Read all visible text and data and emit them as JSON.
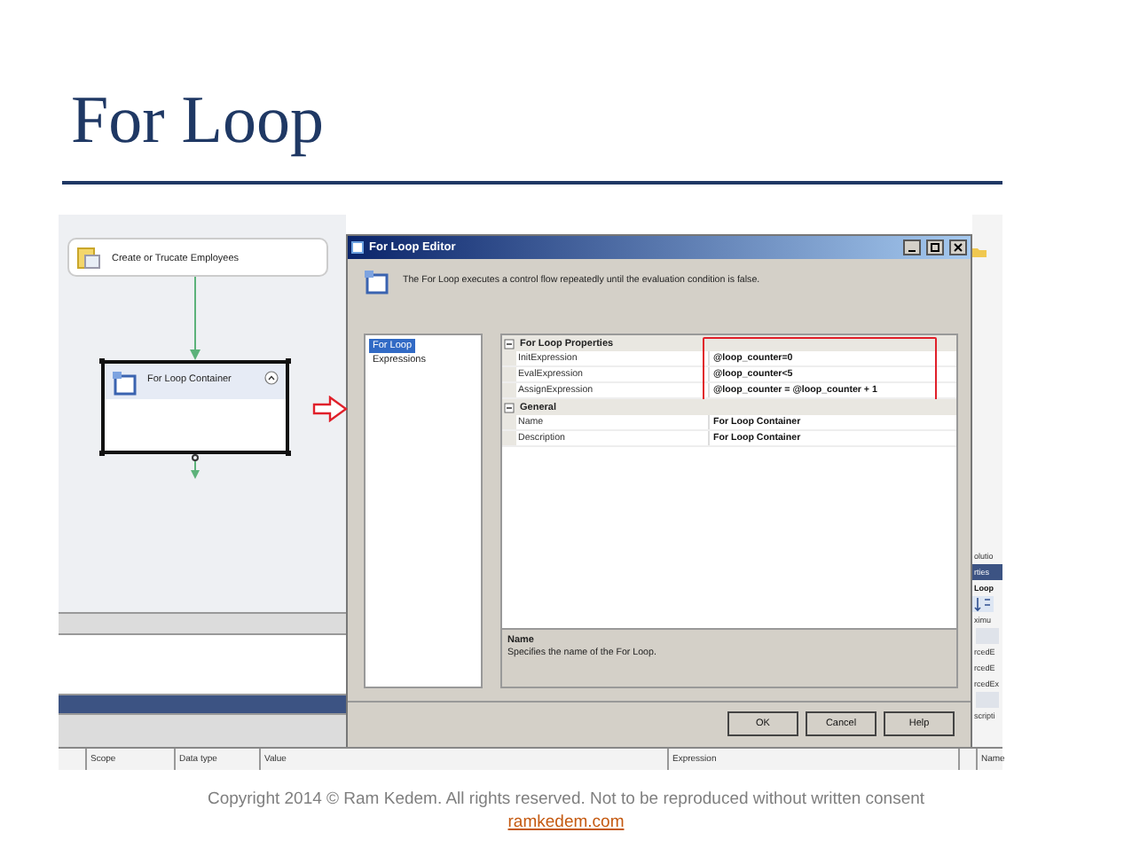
{
  "slide": {
    "title": "For Loop",
    "footer": "Copyright 2014 © Ram Kedem. All rights reserved. Not to be reproduced without written consent",
    "link": "ramkedem.com"
  },
  "designer": {
    "tasks": [
      {
        "label": "Create or Trucate Employees",
        "kind": "task",
        "selected": false
      },
      {
        "label": "For Loop Container",
        "kind": "container",
        "selected": true
      }
    ]
  },
  "dialog": {
    "title": "For Loop Editor",
    "description": "The For Loop executes a control flow repeatedly until the evaluation condition is false.",
    "pages": [
      {
        "label": "For Loop",
        "selected": true
      },
      {
        "label": "Expressions",
        "selected": false
      }
    ],
    "groups": [
      {
        "title": "For Loop Properties",
        "expanded": true,
        "highlighted": true,
        "rows": [
          {
            "name": "InitExpression",
            "value": "@loop_counter=0"
          },
          {
            "name": "EvalExpression",
            "value": "@loop_counter<5"
          },
          {
            "name": "AssignExpression",
            "value": "@loop_counter = @loop_counter + 1"
          }
        ]
      },
      {
        "title": "General",
        "expanded": true,
        "highlighted": false,
        "rows": [
          {
            "name": "Name",
            "value": "For Loop Container"
          },
          {
            "name": "Description",
            "value": "For Loop Container"
          }
        ]
      }
    ],
    "help": {
      "title": "Name",
      "text": "Specifies the name of the For Loop."
    },
    "buttons": [
      "OK",
      "Cancel",
      "Help"
    ]
  },
  "side_panel": [
    {
      "kind": "plain",
      "text": "olutio"
    },
    {
      "kind": "tab",
      "text": "rties"
    },
    {
      "kind": "heading",
      "text": "Loop"
    },
    {
      "kind": "toolbar"
    },
    {
      "kind": "plain",
      "text": "ximu"
    },
    {
      "kind": "faded"
    },
    {
      "kind": "plain",
      "text": "rcedE"
    },
    {
      "kind": "plain",
      "text": "rcedE"
    },
    {
      "kind": "plain",
      "text": "rcedEx"
    },
    {
      "kind": "faded"
    },
    {
      "kind": "plain",
      "text": "scripti"
    }
  ],
  "variables_columns": [
    "Scope",
    "Data type",
    "Value",
    "Expression",
    "Name"
  ]
}
